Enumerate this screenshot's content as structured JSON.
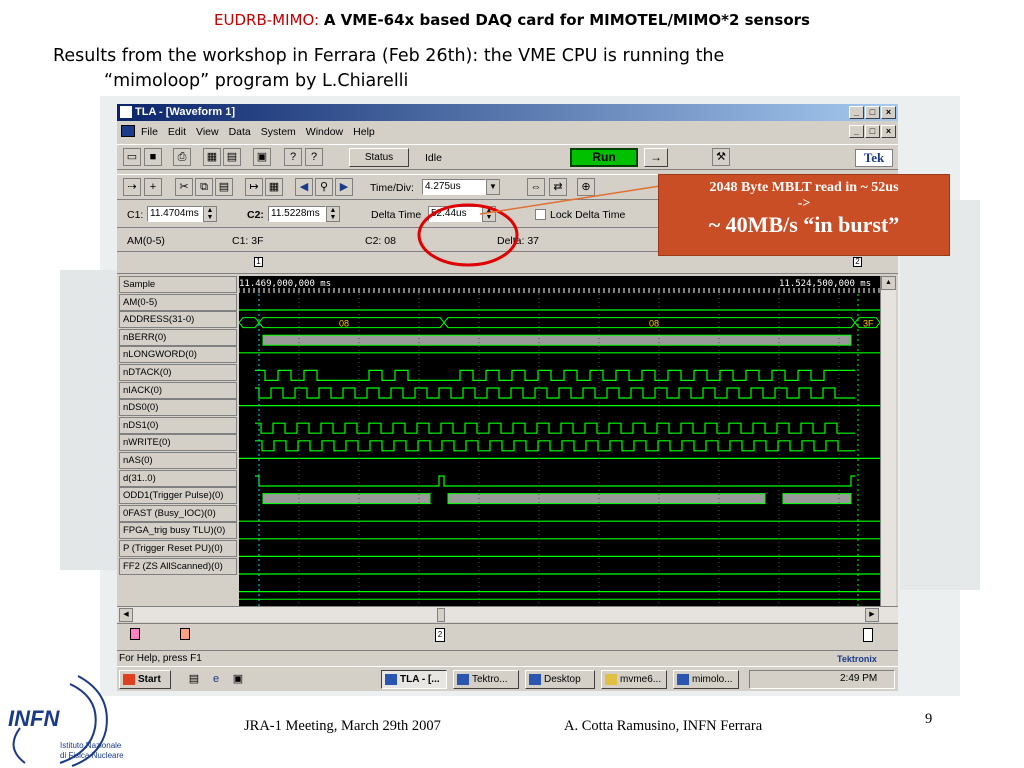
{
  "slide": {
    "title_red": "EUDRB-MIMO:",
    "title_black": "A VME-64x based DAQ card for MIMOTEL/MIMO*2 sensors",
    "subtitle_line1": "Results from the workshop in Ferrara (Feb 26th): the VME CPU is running the",
    "subtitle_line2": "“mimoloop” program by L.Chiarelli",
    "footer_left": "JRA-1 Meeting, March 29th 2007",
    "footer_right": "A. Cotta Ramusino, INFN Ferrara",
    "page_number": "9"
  },
  "callout": {
    "line1": "2048 Byte MBLT read in ~ 52us",
    "line2": "->",
    "line3": "~ 40MB/s “in burst”"
  },
  "logo": {
    "name": "INFN",
    "line1": "Istituto Nazionale",
    "line2": "di Fisica Nucleare",
    "color": "#1a3a8a"
  },
  "app": {
    "window_title": "TLA - [Waveform 1]",
    "menu": [
      "File",
      "Edit",
      "View",
      "Data",
      "System",
      "Window",
      "Help"
    ],
    "status_button": "Status",
    "status_text": "Idle",
    "run_button": "Run",
    "arrow_button": "→",
    "tek_logo": "Tek",
    "timediv_label": "Time/Div:",
    "timediv_value": "4.275us",
    "c1_label": "C1:",
    "c1_value": "11.4704ms",
    "c2_label": "C2:",
    "c2_value": "11.5228ms",
    "delta_time_label": "Delta Time",
    "delta_time_value": "52.44us",
    "lock_delta_label": "Lock Delta Time",
    "readout": {
      "group": "AM(0-5)",
      "c1": "C1: 3F",
      "c2": "C2: 08",
      "delta": "Delta:  37"
    },
    "cursor1_label": "1",
    "cursor2_label": "2",
    "time_left": "11.469,000,000 ms",
    "time_right": "11.524,500,000 ms",
    "signals": [
      "Sample",
      "AM(0-5)",
      "ADDRESS(31-0)",
      "nBERR(0)",
      "nLONGWORD(0)",
      "nDTACK(0)",
      "nIACK(0)",
      "nDS0(0)",
      "nDS1(0)",
      "nWRITE(0)",
      "nAS(0)",
      "d(31..0)",
      "ODD1(Trigger Pulse)(0)",
      "0FAST (Busy_IOC)(0)",
      "FPGA_trig busy TLU)(0)",
      "P (Trigger Reset PU)(0)",
      "FF2 (ZS AllScanned)(0)"
    ],
    "bus_values": {
      "am_left": "08",
      "am_right": "08",
      "am_end": "3F"
    },
    "status_bar": "For Help, press F1",
    "status_brand": "Tektronix",
    "taskbar": {
      "start": "Start",
      "tasks": [
        "TLA - [...",
        "Tektro...",
        "Desktop",
        "mvme6...",
        "mimolo..."
      ],
      "clock": "2:49 PM"
    }
  },
  "colors": {
    "title_red": "#c00000",
    "callout_bg": "#c94e25",
    "annotation_red": "#e00000",
    "wave_green": "#00ff00",
    "window_bg": "#d4d0c8"
  }
}
